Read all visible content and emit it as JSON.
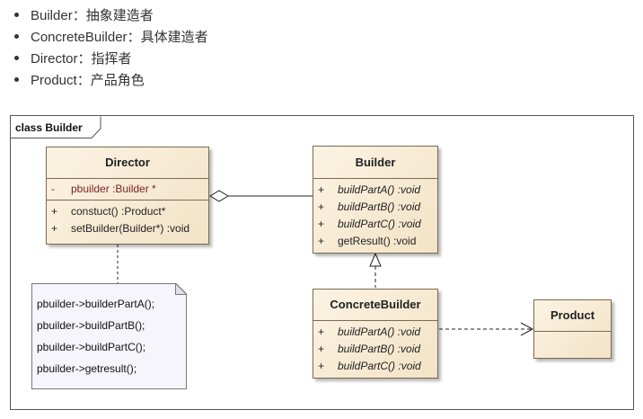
{
  "bullets": [
    {
      "name": "Builder",
      "sep": "：",
      "desc": "抽象建造者"
    },
    {
      "name": "ConcreteBuilder",
      "sep": "：",
      "desc": "具体建造者"
    },
    {
      "name": "Director",
      "sep": "：",
      "desc": "指挥者"
    },
    {
      "name": "Product",
      "sep": "：",
      "desc": "产品角色"
    }
  ],
  "frame": {
    "label": "class Builder"
  },
  "director": {
    "name": "Director",
    "attr": {
      "vis": "-",
      "text": "pbuilder  :Builder *"
    },
    "ops": [
      {
        "vis": "+",
        "text": "constuct()  :Product*"
      },
      {
        "vis": "+",
        "text": "setBuilder(Builder*)  :void"
      }
    ]
  },
  "builder": {
    "name": "Builder",
    "ops": [
      {
        "vis": "+",
        "text": "buildPartA()  :void"
      },
      {
        "vis": "+",
        "text": "buildPartB()  :void"
      },
      {
        "vis": "+",
        "text": "buildPartC()  :void"
      },
      {
        "vis": "+",
        "text": "getResult()  :void"
      }
    ]
  },
  "concrete": {
    "name": "ConcreteBuilder",
    "ops": [
      {
        "vis": "+",
        "text": "buildPartA()  :void"
      },
      {
        "vis": "+",
        "text": "buildPartB()  :void"
      },
      {
        "vis": "+",
        "text": "buildPartC()  :void"
      }
    ]
  },
  "product": {
    "name": "Product"
  },
  "note": {
    "lines": [
      "pbuilder->builderPartA();",
      "pbuilder->buildPartB();",
      "pbuilder->buildPartC();",
      "pbuilder->getresult();"
    ]
  },
  "colors": {
    "class_fill": "#f3e3c6",
    "class_border": "#7a6a50",
    "note_fill": "#f6f5fb",
    "attr_text": "#7a1f1f"
  }
}
